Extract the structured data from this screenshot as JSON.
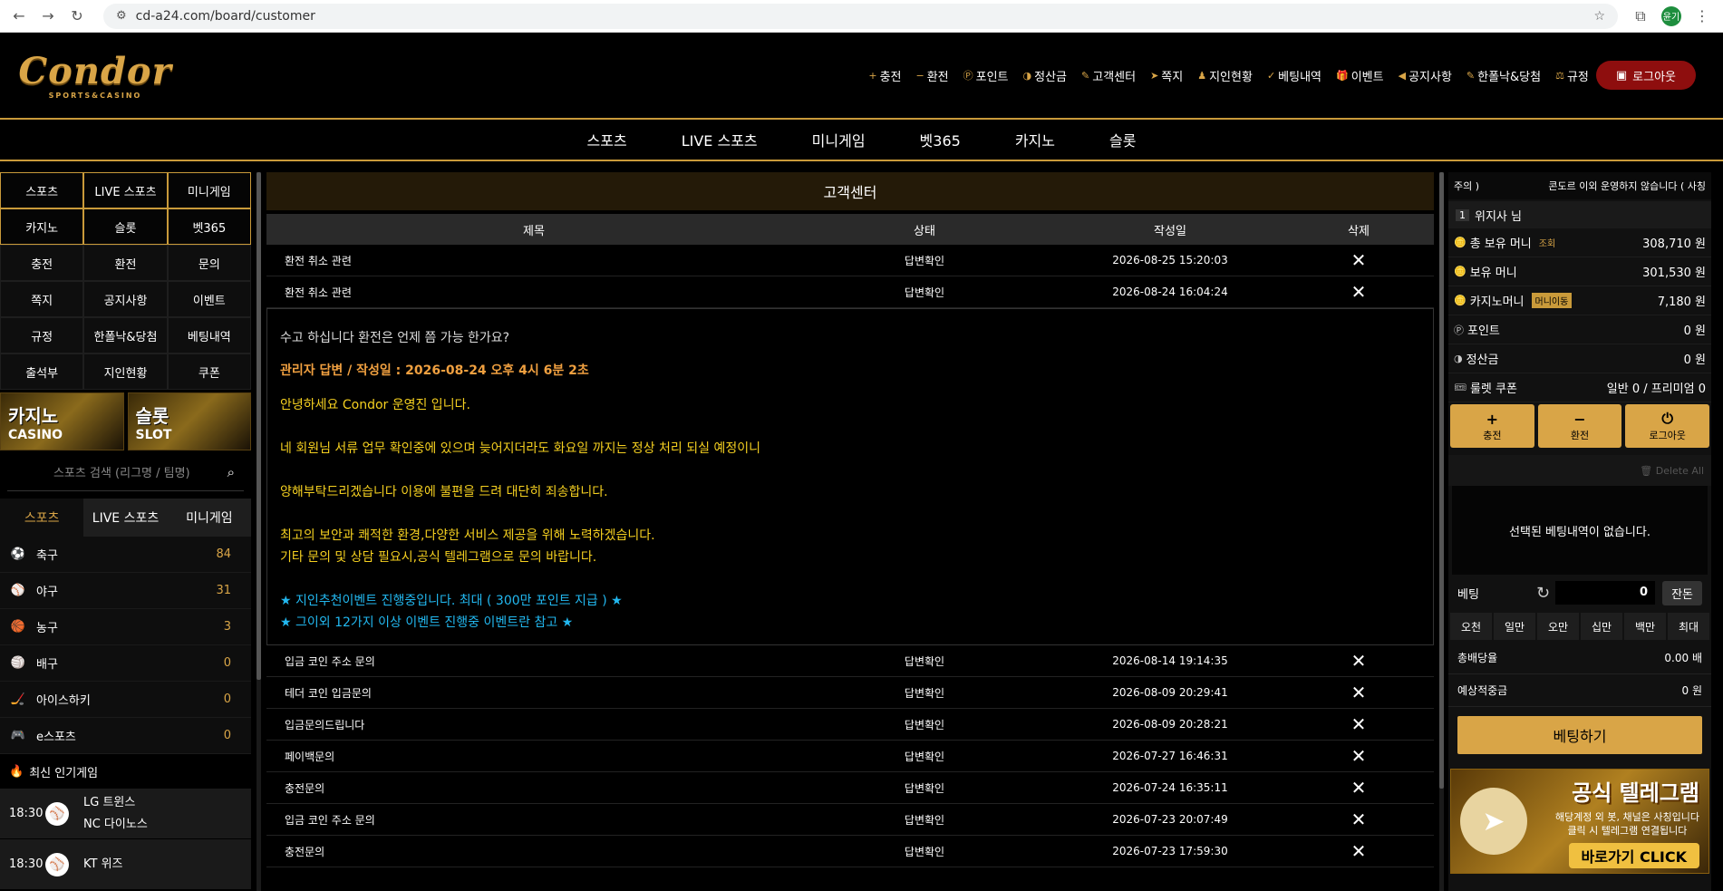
{
  "browser": {
    "url": "cd-a24.com/board/customer",
    "profile": "윤기"
  },
  "logo": {
    "main": "Condor",
    "sub": "SPORTS&CASINO"
  },
  "topnav": [
    {
      "icon": "+",
      "label": "충전"
    },
    {
      "icon": "−",
      "label": "환전"
    },
    {
      "icon": "Ⓟ",
      "label": "포인트"
    },
    {
      "icon": "◑",
      "label": "정산금"
    },
    {
      "icon": "✎",
      "label": "고객센터"
    },
    {
      "icon": "➤",
      "label": "쪽지"
    },
    {
      "icon": "♟",
      "label": "지인현황"
    },
    {
      "icon": "✓",
      "label": "베팅내역"
    },
    {
      "icon": "🎁",
      "label": "이벤트"
    },
    {
      "icon": "◀",
      "label": "공지사항"
    },
    {
      "icon": "✎",
      "label": "한폴낙&당첨"
    },
    {
      "icon": "⚖",
      "label": "규정"
    }
  ],
  "logout_label": "로그아웃",
  "subnav": [
    "스포츠",
    "LIVE 스포츠",
    "미니게임",
    "벳365",
    "카지노",
    "슬롯"
  ],
  "left": {
    "tabs": [
      "스포츠",
      "LIVE 스포츠",
      "미니게임",
      "카지노",
      "슬롯",
      "벳365"
    ],
    "menu": [
      "충전",
      "환전",
      "문의",
      "쪽지",
      "공지사항",
      "이벤트",
      "규정",
      "한폴낙&당첨",
      "베팅내역",
      "출석부",
      "지인현황",
      "쿠폰"
    ],
    "banners": [
      {
        "kr": "카지노",
        "en": "CASINO"
      },
      {
        "kr": "슬롯",
        "en": "SLOT"
      }
    ],
    "search_placeholder": "스포츠 검색 (리그명 / 팀명)",
    "sport_tabs": [
      "스포츠",
      "LIVE 스포츠",
      "미니게임"
    ],
    "sports": [
      {
        "name": "축구",
        "count": "84",
        "icon": "⚽",
        "color": "#fff"
      },
      {
        "name": "야구",
        "count": "31",
        "icon": "⚾",
        "color": "#fff"
      },
      {
        "name": "농구",
        "count": "3",
        "icon": "🏀",
        "color": "#e07020"
      },
      {
        "name": "배구",
        "count": "0",
        "icon": "🏐",
        "color": "#f0c030"
      },
      {
        "name": "아이스하키",
        "count": "0",
        "icon": "🏒",
        "color": "#3a8fd0"
      },
      {
        "name": "e스포츠",
        "count": "0",
        "icon": "🎮",
        "color": "#e05050"
      }
    ],
    "popular_title": "최신 인기게임",
    "games": [
      {
        "time": "18:30",
        "home": "LG 트윈스",
        "away": "NC 다이노스"
      },
      {
        "time": "18:30",
        "home": "KT 위즈",
        "away": ""
      }
    ]
  },
  "board": {
    "title": "고객센터",
    "columns": [
      "제목",
      "상태",
      "작성일",
      "삭제"
    ],
    "top_rows": [
      {
        "title": "환전 취소 관련",
        "status": "답변확인",
        "date": "2026-08-25 15:20:03"
      },
      {
        "title": "환전 취소 관련",
        "status": "답변확인",
        "date": "2026-08-24 16:04:24"
      }
    ],
    "detail": {
      "question": "수고 하십니다 환전은 언제 쯤 가능 한가요?",
      "answer_header": "관리자 답변 / 작성일 : 2026-08-24 오후 4시 6분 2초",
      "lines": [
        "안녕하세요 Condor 운영진 입니다.",
        "네 회원님 서류 업무 확인중에 있으며 늦어지더라도 화요일 까지는 정상 처리 되실 예정이니",
        "양해부탁드리겠습니다 이용에 불편을 드려 대단히 죄송합니다.",
        "최고의 보안과 쾌적한 환경,다양한 서비스 제공을 위해 노력하겠습니다.",
        "기타 문의 및 상담 필요시,공식 텔레그램으로 문의 바랍니다.",
        "★ 지인추천이벤트 진행중입니다. 최대 ( 300만 포인트 지급 ) ★",
        "★ 그이외 12가지 이상 이벤트 진행중 이벤트란 참고 ★"
      ]
    },
    "rows": [
      {
        "title": "입금 코인 주소 문의",
        "status": "답변확인",
        "date": "2026-08-14 19:14:35"
      },
      {
        "title": "테더 코인 입금문의",
        "status": "답변확인",
        "date": "2026-08-09 20:29:41"
      },
      {
        "title": "입금문의드립니다",
        "status": "답변확인",
        "date": "2026-08-09 20:28:21"
      },
      {
        "title": "페이백문의",
        "status": "답변확인",
        "date": "2026-07-27 16:46:31"
      },
      {
        "title": "충전문의",
        "status": "답변확인",
        "date": "2026-07-24 16:35:11"
      },
      {
        "title": "입금 코인 주소 문의",
        "status": "답변확인",
        "date": "2026-07-23 20:07:49"
      },
      {
        "title": "충전문의",
        "status": "답변확인",
        "date": "2026-07-23 17:59:30"
      }
    ]
  },
  "right": {
    "notice_label": "주의 )",
    "notice_text": "콘도르 이외 운영하지 않습니다 ( 사칭",
    "user": {
      "level": "1",
      "name": "위지사 님"
    },
    "info": [
      {
        "label": "총 보유 머니",
        "badge": "조회",
        "value": "308,710 원"
      },
      {
        "label": "보유 머니",
        "value": "301,530 원"
      },
      {
        "label": "카지노머니",
        "bbadge": "머니이동",
        "value": "7,180 원"
      },
      {
        "label": "포인트",
        "value": "0 원"
      },
      {
        "label": "정산금",
        "value": "0 원"
      },
      {
        "label": "룰렛 쿠폰",
        "value": "일반 0 / 프리미엄 0"
      }
    ],
    "buttons": [
      {
        "icon": "+",
        "label": "충전"
      },
      {
        "icon": "−",
        "label": "환전"
      },
      {
        "icon": "⏻",
        "label": "로그아웃"
      }
    ],
    "delete_all": "Delete All",
    "empty": "선택된 베팅내역이 없습니다.",
    "bet_label": "베팅",
    "bet_value": "0",
    "balance_label": "잔돈",
    "chips": [
      "오천",
      "일만",
      "오만",
      "십만",
      "백만",
      "최대"
    ],
    "total_odds_label": "총배당율",
    "total_odds": "0.00 배",
    "expected_label": "예상적중금",
    "expected": "0 원",
    "bet_button": "베팅하기",
    "telegram": {
      "title": "공식 텔레그램",
      "desc1": "해당계정 외 봇, 채널은 사칭입니다",
      "desc2": "클릭 시 텔레그램 연결됩니다",
      "cta": "바로가기 CLICK"
    }
  }
}
